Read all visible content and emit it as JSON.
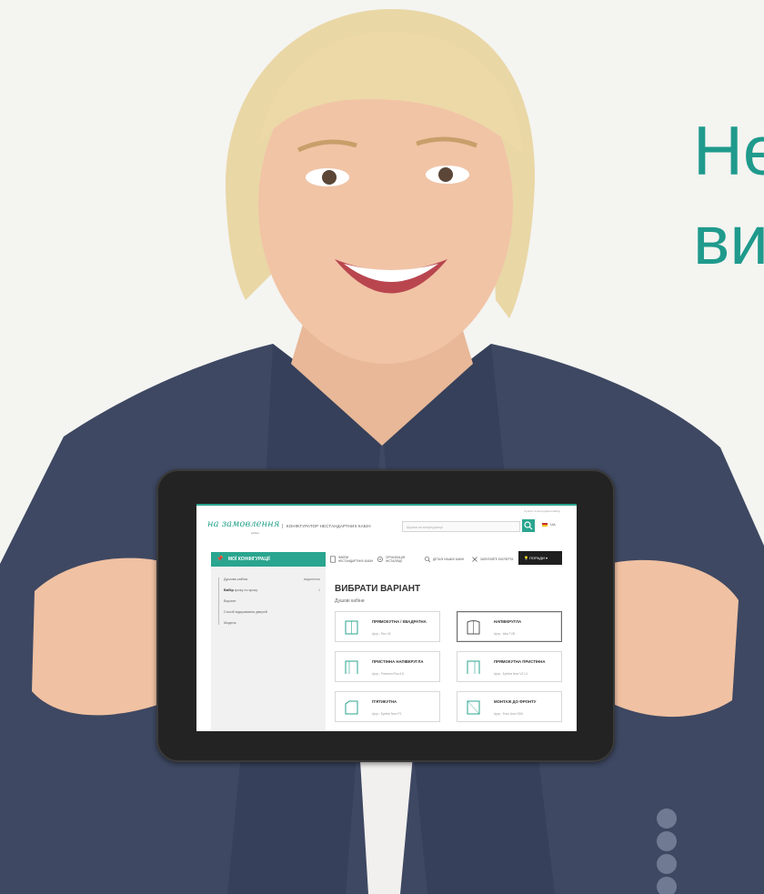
{
  "headline": {
    "line1": "Не",
    "line2": "ви"
  },
  "colors": {
    "accent": "#2aa58f",
    "headline": "#1f9a8c",
    "jacket": "#3e4862",
    "tablet_bezel": "#232323"
  },
  "site": {
    "utility_text": "Купити та інтегрувати кабіну",
    "logo_text": "на замовлення",
    "logo_sub": "кабіни",
    "title": "КОНФІГУРАТОР НЕСТАНДАРТНИХ КАБІН",
    "search_placeholder": "Шукати на конфігураторі",
    "search_icon": "search-icon",
    "language": "UA"
  },
  "sidebar": {
    "header": "МОЇ КОНФІГУРАЦІЇ",
    "header_icon": "pin-icon",
    "items": [
      {
        "label": "Душова кабіна",
        "right": "видалення"
      },
      {
        "label_bold": "Вибір",
        "label": " кроку по кроку",
        "right": "1"
      },
      {
        "label": "Варіант",
        "right": ""
      },
      {
        "label": "Спосіб відкривання дверей",
        "right": ""
      },
      {
        "label": "Модель",
        "right": ""
      }
    ]
  },
  "nav": {
    "items": [
      {
        "label": "ФАЙЛИ НЕСТАНДАРТНИХ КАБІН",
        "icon": "document-icon"
      },
      {
        "label": "ОРГАНІЗАЦІЯ ІНСТАЛЯЦІЇ",
        "icon": "gear-icon"
      },
      {
        "label": "ДЕТАЛІ НАШИХ КАБІН",
        "icon": "magnifier-icon"
      },
      {
        "label": "ЗАПИТАЙТЕ ЕКСПЕРТА",
        "icon": "tools-icon"
      }
    ],
    "help_label": "ПОРАДИ",
    "help_icon": "bulb-icon"
  },
  "main": {
    "title": "ВИБРАТИ ВАРІАНТ",
    "subtitle": "Душові кабіни",
    "cards": [
      {
        "title": "ПРЯМОКУТНА / КВАДРАТНА",
        "article": "Артр.: Fino Xll",
        "selected": false
      },
      {
        "title": "НАПІВКРУГЛА",
        "article": "Артр.: Idea TVB",
        "selected": true
      },
      {
        "title": "ПРИСТІННА НАПІВКРУГЛА",
        "article": "Артр.: Premium Plus 6.8",
        "selected": false
      },
      {
        "title": "ПРЯМОКУТНА ПРИСТІННА",
        "article": "Артр.: Eyeline New VZ LX",
        "selected": false
      },
      {
        "title": "П'ЯТИКУТНА",
        "article": "Артр.: Eyeline New P2",
        "selected": false
      },
      {
        "title": "МОНТАЖ ДО ФРОНТУ",
        "article": "Артр.: Funs Liner SSU",
        "selected": false
      }
    ]
  }
}
